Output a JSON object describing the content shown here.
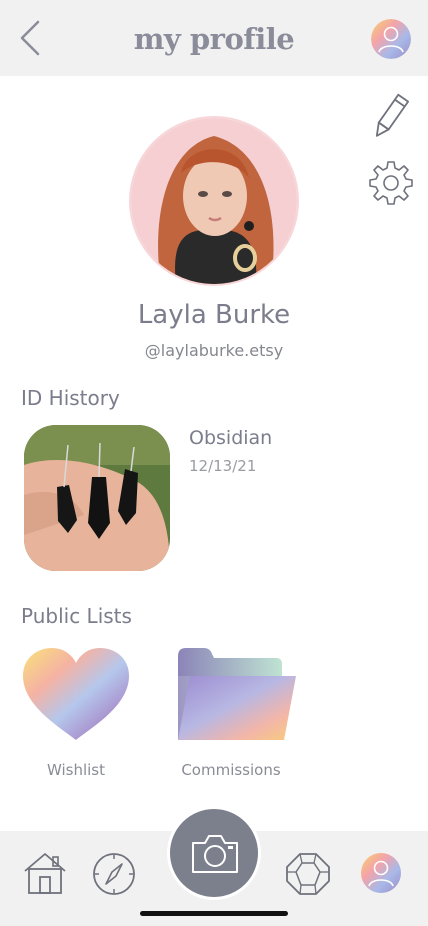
{
  "header": {
    "title": "my profile",
    "back_icon": "chevron-left-icon",
    "account_icon": "user-avatar-icon"
  },
  "profile": {
    "name": "Layla Burke",
    "handle": "@laylaburke.etsy",
    "edit_icon": "pencil-icon",
    "settings_icon": "gear-icon"
  },
  "id_history": {
    "heading": "ID History",
    "items": [
      {
        "name": "Obsidian",
        "date": "12/13/21"
      }
    ]
  },
  "public_lists": {
    "heading": "Public Lists",
    "items": [
      {
        "label": "Wishlist",
        "icon": "heart-icon"
      },
      {
        "label": "Commissions",
        "icon": "folder-icon"
      }
    ]
  },
  "bottom_nav": {
    "items": [
      "home-icon",
      "compass-icon",
      "camera-icon",
      "gem-icon",
      "profile-icon"
    ]
  },
  "colors": {
    "bar": "#f1f1f1",
    "text": "#7b7d8c",
    "camera_button": "#7c7f8c"
  }
}
